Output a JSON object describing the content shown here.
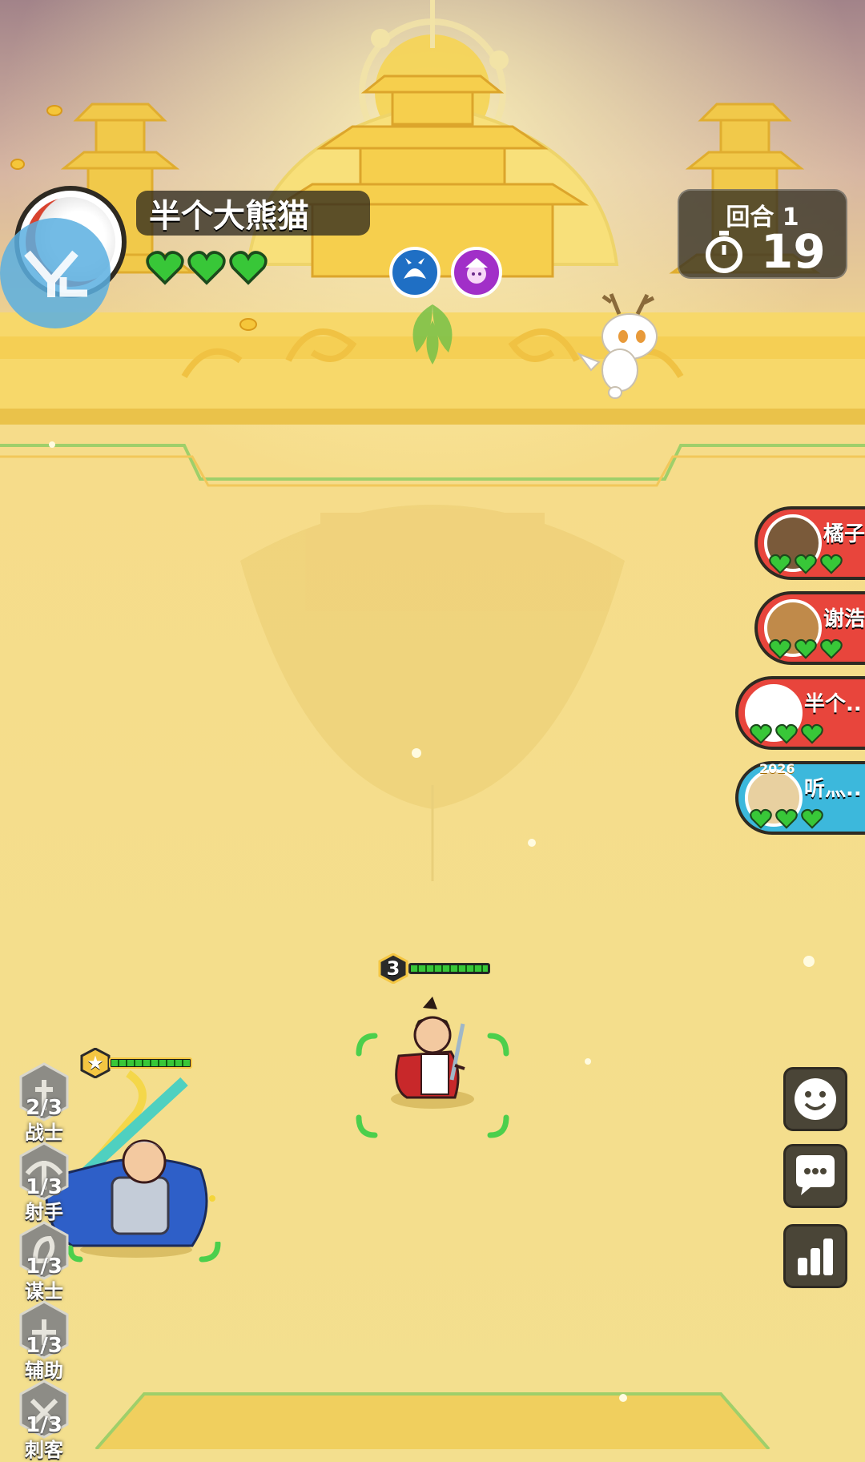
{
  "player": {
    "name": "半个大熊猫",
    "lives": 3,
    "skills": [
      "spirit-fox-icon",
      "jester-icon"
    ]
  },
  "round": {
    "label": "回合 1",
    "timer": "19"
  },
  "opponents": [
    {
      "name": "橘子",
      "lives": 3,
      "color": "#e8453c"
    },
    {
      "name": "谢浩",
      "lives": 3,
      "color": "#e8453c"
    },
    {
      "name": "半个..",
      "lives": 3,
      "color": "#e8453c"
    },
    {
      "name": "听灬..",
      "lives": 3,
      "color": "#3cb8dc",
      "badge": "2026"
    }
  ],
  "units": {
    "swordsman": {
      "level": "3",
      "hp": 1.0
    },
    "general": {
      "level": "★",
      "hp": 1.0
    }
  },
  "classes": [
    {
      "count": "2/3",
      "name": "战士"
    },
    {
      "count": "1/3",
      "name": "射手"
    },
    {
      "count": "1/3",
      "name": "谋士"
    },
    {
      "count": "1/3",
      "name": "辅助"
    },
    {
      "count": "1/3",
      "name": "刺客"
    }
  ],
  "buttons": [
    "emoji-icon",
    "chat-icon",
    "stats-icon"
  ],
  "colors": {
    "heart": "#38c738",
    "panel": "#322e24",
    "gold": "#f3df8e"
  }
}
